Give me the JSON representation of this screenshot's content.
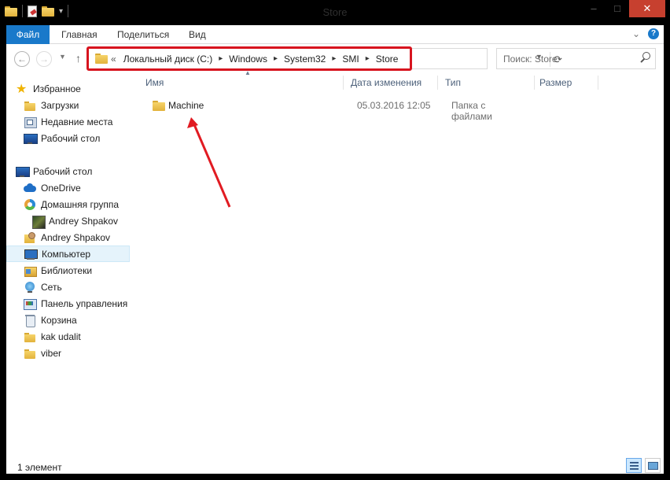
{
  "window": {
    "title": "Store",
    "controls": {
      "minimize": "–",
      "maximize": "□",
      "close": "✕"
    }
  },
  "ribbon": {
    "tabs": [
      "Файл",
      "Главная",
      "Поделиться",
      "Вид"
    ]
  },
  "address": {
    "overflow": "«",
    "crumbs": [
      "Локальный диск (C:)",
      "Windows",
      "System32",
      "SMI",
      "Store"
    ]
  },
  "search": {
    "placeholder": "Поиск: Store"
  },
  "sidebar": {
    "items": [
      {
        "label": "Избранное",
        "icon": "star-icon"
      },
      {
        "label": "Загрузки",
        "icon": "folder-icon"
      },
      {
        "label": "Недавние места",
        "icon": "recent-places-icon"
      },
      {
        "label": "Рабочий стол",
        "icon": "desktop-icon"
      },
      {
        "label": "Рабочий стол",
        "icon": "desktop-icon"
      },
      {
        "label": "OneDrive",
        "icon": "onedrive-icon"
      },
      {
        "label": "Домашняя группа",
        "icon": "homegroup-icon"
      },
      {
        "label": "Andrey Shpakov",
        "icon": "user-avatar-icon"
      },
      {
        "label": "Andrey Shpakov",
        "icon": "user-folder-icon"
      },
      {
        "label": "Компьютер",
        "icon": "computer-icon"
      },
      {
        "label": "Библиотеки",
        "icon": "libraries-icon"
      },
      {
        "label": "Сеть",
        "icon": "network-icon"
      },
      {
        "label": "Панель управления",
        "icon": "control-panel-icon"
      },
      {
        "label": "Корзина",
        "icon": "recycle-bin-icon"
      },
      {
        "label": "kak udalit",
        "icon": "folder-icon"
      },
      {
        "label": "viber",
        "icon": "folder-icon"
      }
    ],
    "selected": "Компьютер"
  },
  "columns": [
    "Имя",
    "Дата изменения",
    "Тип",
    "Размер"
  ],
  "files": [
    {
      "name": "Machine",
      "date": "05.03.2016 12:05",
      "type": "Папка с файлами",
      "size": ""
    }
  ],
  "status": {
    "text": "1 элемент"
  },
  "colors": {
    "accent": "#1979ca",
    "highlight": "#d7141f",
    "selection": "#e5f3fb"
  }
}
